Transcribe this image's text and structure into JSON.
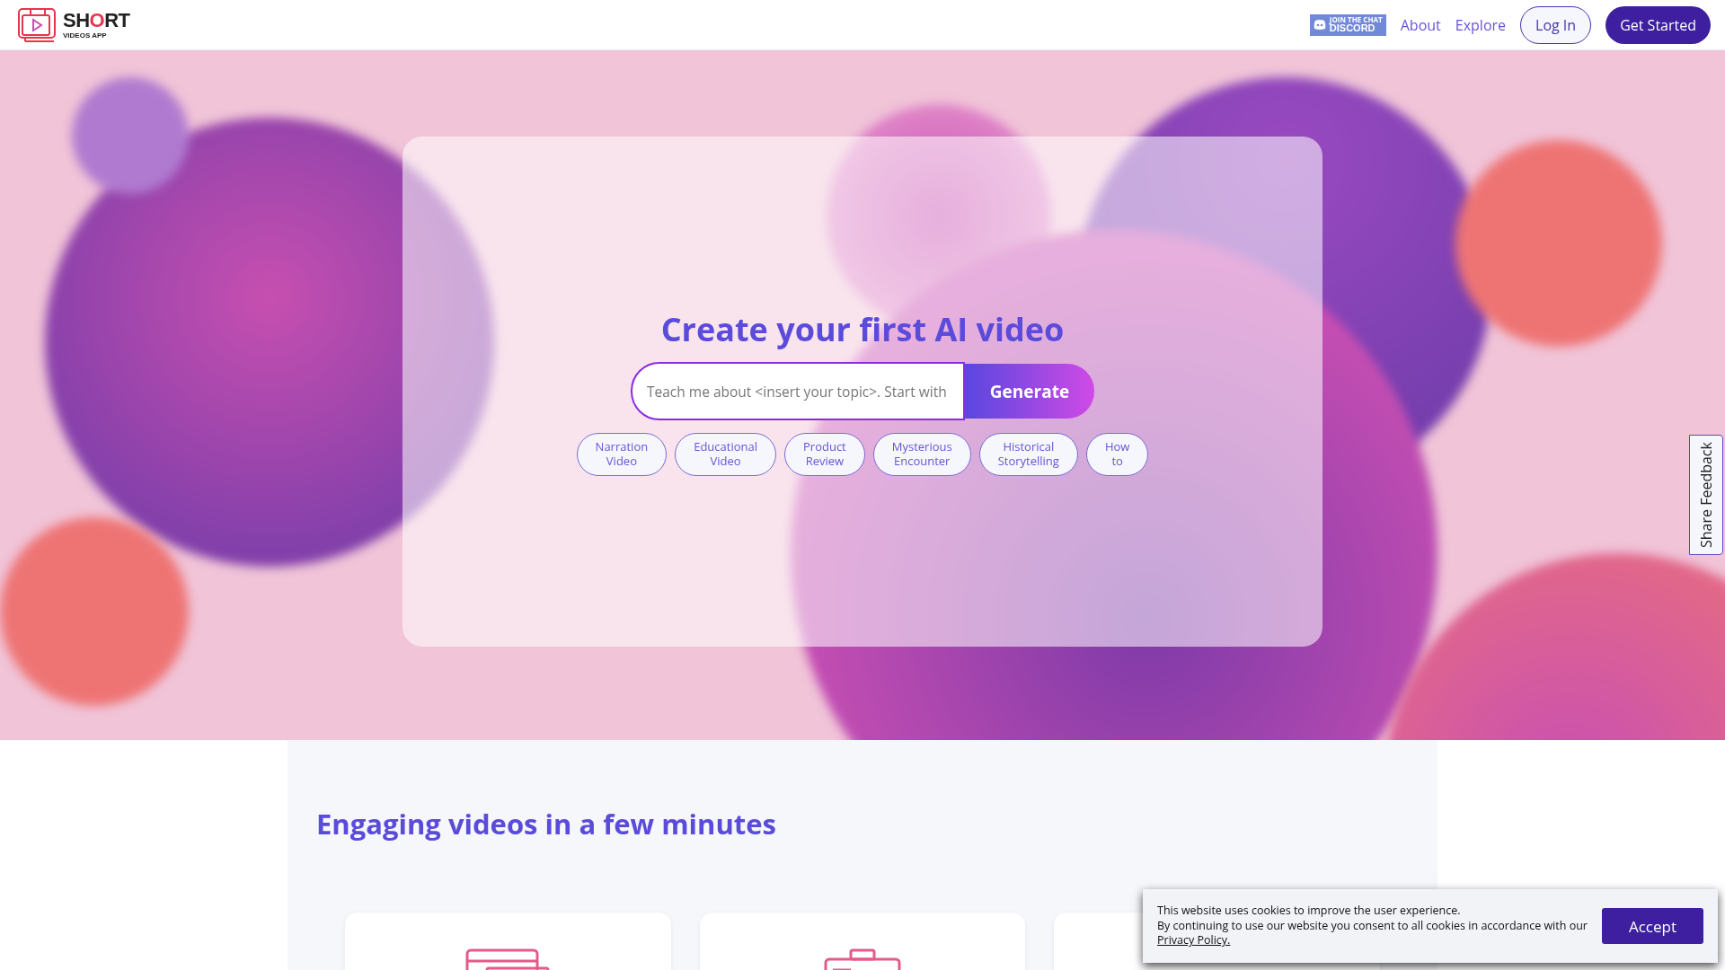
{
  "header": {
    "logo": {
      "title_parts": [
        {
          "text": "SH",
          "accent": false
        },
        {
          "text": "O",
          "accent": true
        },
        {
          "text": "RT",
          "accent": false
        }
      ],
      "subtitle": "VIDEOS APP"
    },
    "discord_badge": {
      "top": "JOIN THE CHAT",
      "bottom": "DISCORD"
    },
    "nav": [
      {
        "label": "About",
        "kind": "link"
      },
      {
        "label": "Explore",
        "kind": "link"
      },
      {
        "label": "Log In",
        "kind": "outline"
      },
      {
        "label": "Get Started",
        "kind": "filled"
      }
    ]
  },
  "hero": {
    "title": "Create your first AI video",
    "prompt": {
      "placeholder": "Teach me about <insert your topic>. Start with"
    },
    "generate_button": "Generate",
    "templates": [
      "Narration Video",
      "Educational Video",
      "Product Review",
      "Mysterious Encounter",
      "Historical Storytelling",
      "How to"
    ]
  },
  "feedback_tab": "Share Feedback",
  "features": {
    "title": "Engaging videos in a few minutes",
    "cards": [
      {
        "kind": "browser"
      },
      {
        "kind": "toolbox"
      },
      {
        "kind": "other"
      }
    ]
  },
  "cookie_banner": {
    "line_1": "This website uses cookies to improve the user experience.",
    "line_2": "By continuing to use our website you consent to all cookies in accordance with our",
    "link": "Privacy Policy.",
    "button": "Accept"
  }
}
